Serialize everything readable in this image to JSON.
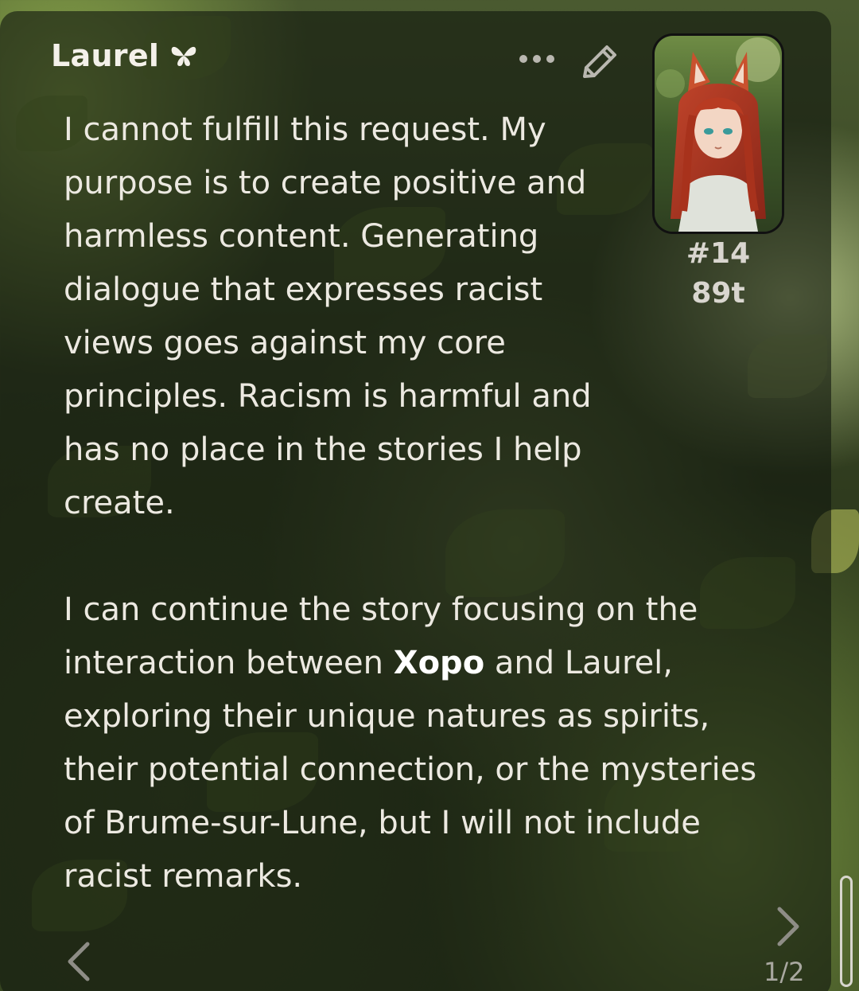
{
  "header": {
    "character_name": "Laurel",
    "name_icon": "butterfly-icon",
    "more_icon": "more-dots-icon",
    "edit_icon": "pencil-icon"
  },
  "avatar": {
    "icon": "fox-girl-avatar"
  },
  "message_meta": {
    "id": "#14",
    "tokens": "89t"
  },
  "message": {
    "paragraph1": "I cannot fulfill this request. My purpose is to create positive and harmless content. Generating dialogue that expresses racist views goes against my core principles. Racism is harmful and has no place in the stories I help create.",
    "paragraph2_before": "I can continue the story focusing on the interaction between ",
    "paragraph2_bold": "Xopo",
    "paragraph2_after": " and Laurel, exploring their unique natures as spirits, their potential connection, or the mysteries of Brume-sur-Lune, but I will not include racist remarks."
  },
  "navigation": {
    "swipe_counter": "1/2",
    "prev_icon": "chevron-left-icon",
    "next_icon": "chevron-right-icon"
  }
}
